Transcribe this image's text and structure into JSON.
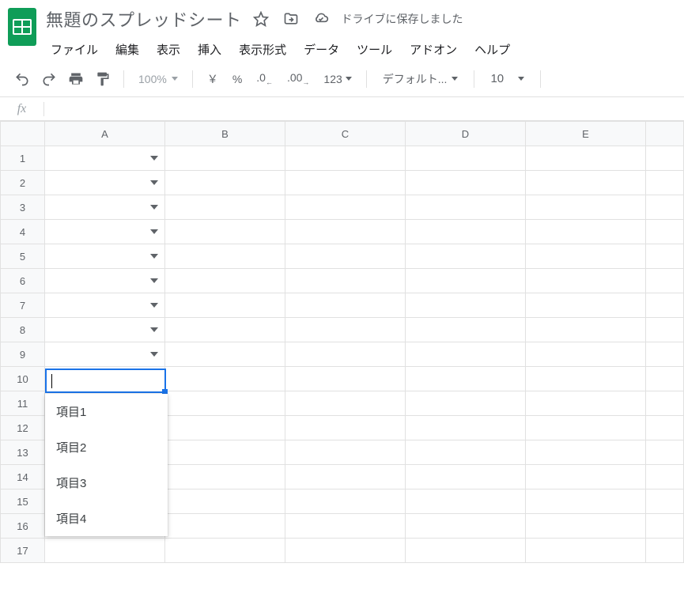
{
  "doc_title": "無題のスプレッドシート",
  "save_status": "ドライブに保存しました",
  "menu": {
    "file": "ファイル",
    "edit": "編集",
    "view": "表示",
    "insert": "挿入",
    "format": "表示形式",
    "data": "データ",
    "tools": "ツール",
    "addons": "アドオン",
    "help": "ヘルプ"
  },
  "toolbar": {
    "zoom": "100%",
    "yen": "￥",
    "percent": "%",
    "dec_less": ".0",
    "dec_more": ".00",
    "num123": "123",
    "font": "デフォルト...",
    "font_size": "10"
  },
  "formula": {
    "fx": "fx",
    "value": ""
  },
  "columns": [
    "A",
    "B",
    "C",
    "D",
    "E"
  ],
  "rows": [
    "1",
    "2",
    "3",
    "4",
    "5",
    "6",
    "7",
    "8",
    "9",
    "10",
    "11",
    "12",
    "13",
    "14",
    "15",
    "16",
    "17"
  ],
  "data_validation": {
    "options": [
      "項目1",
      "項目2",
      "項目3",
      "項目4"
    ]
  }
}
